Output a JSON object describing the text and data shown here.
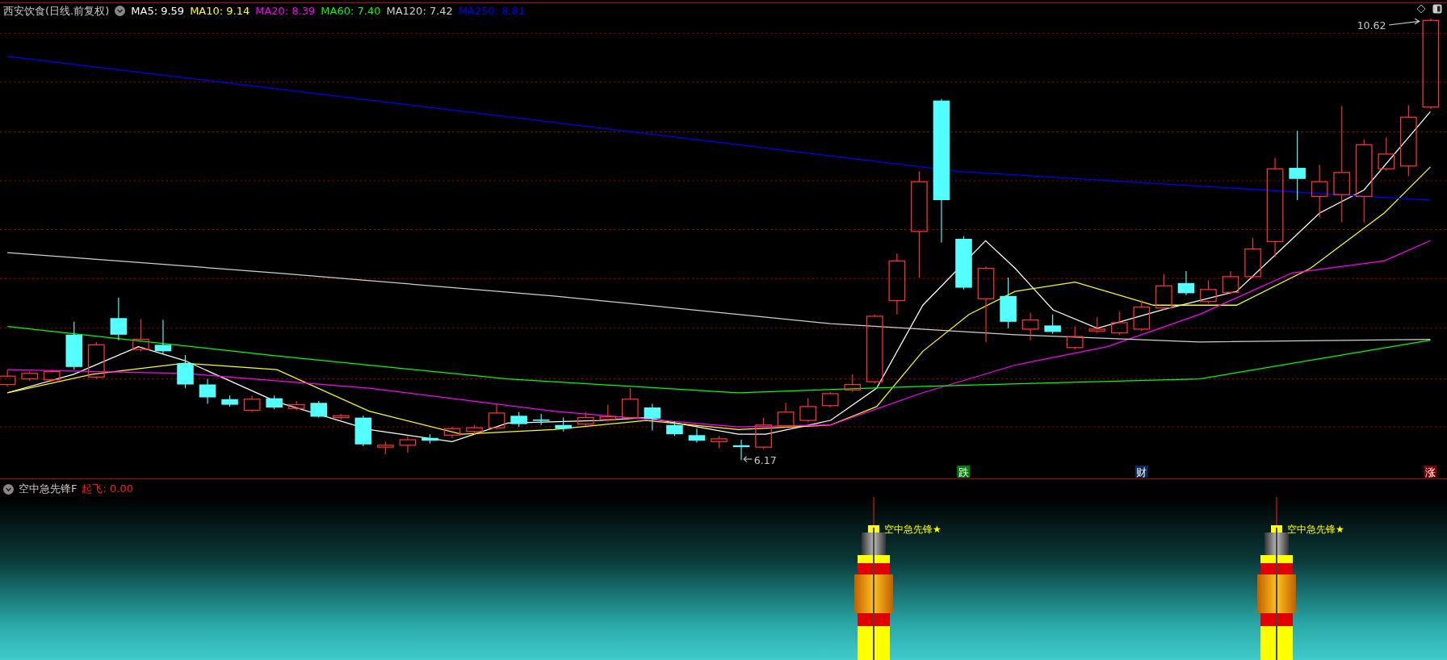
{
  "header": {
    "title": "西安饮食(日线.前复权)",
    "indicators": [
      {
        "label": "MA5: 9.59",
        "color": "#ffffff"
      },
      {
        "label": "MA10: 9.14",
        "color": "#ffff00"
      },
      {
        "label": "MA20: 8.39",
        "color": "#ff00ff"
      },
      {
        "label": "MA60: 7.40",
        "color": "#00ff00"
      },
      {
        "label": "MA120: 7.42",
        "color": "#d0d0d0"
      },
      {
        "label": "MA250: 8.81",
        "color": "#0000ff"
      }
    ]
  },
  "main_chart": {
    "high_label": "10.62",
    "low_label": "6.17",
    "markers": [
      {
        "text": "跌",
        "color": "#008000"
      },
      {
        "text": "财",
        "color": "#0a2a5a"
      },
      {
        "text": "涨",
        "color": "#800000"
      }
    ]
  },
  "indicator_panel": {
    "title": "空中急先锋F",
    "reading": "起飞: 0.00",
    "signals": [
      "空中急先锋★",
      "空中急先锋★"
    ]
  }
}
